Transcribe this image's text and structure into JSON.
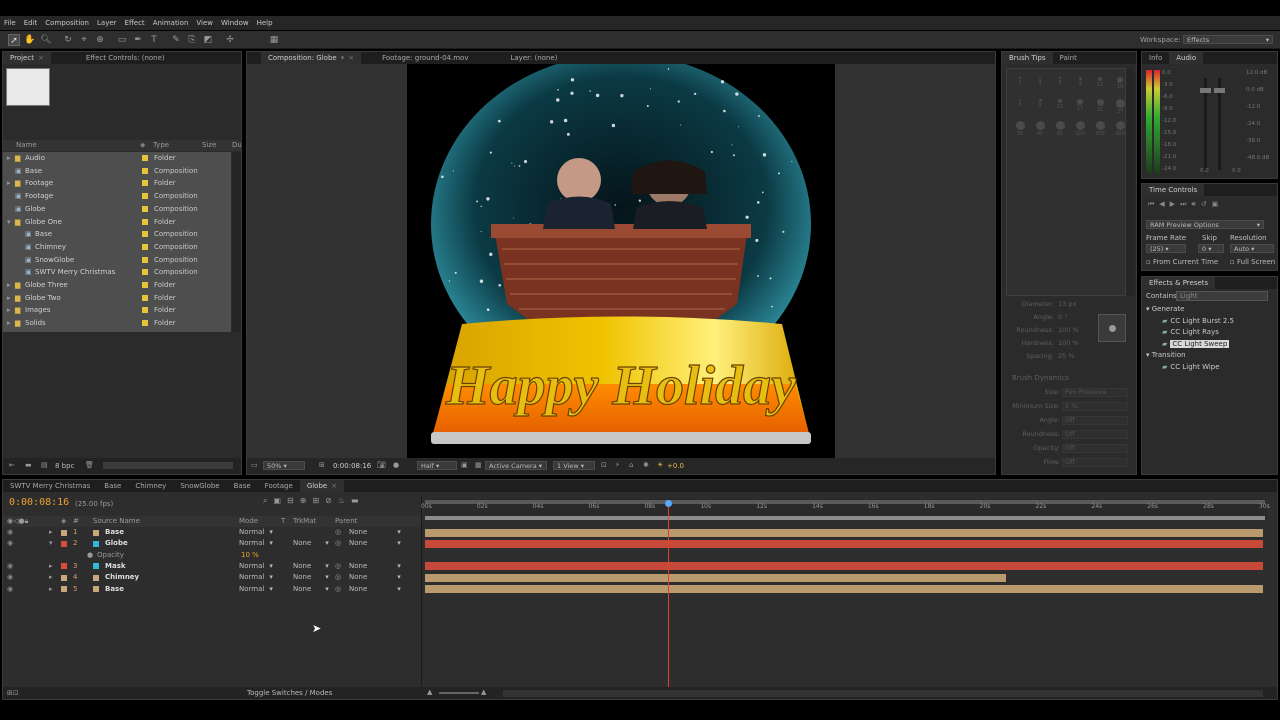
{
  "menu": [
    "File",
    "Edit",
    "Composition",
    "Layer",
    "Effect",
    "Animation",
    "View",
    "Window",
    "Help"
  ],
  "workspace": {
    "label": "Workspace:",
    "value": "Effects"
  },
  "project": {
    "tabs": [
      "Project",
      "Effect Controls: (none)"
    ],
    "columns": [
      "Name",
      "Type",
      "Size",
      "Du"
    ],
    "items": [
      {
        "name": "Audio",
        "type": "Folder",
        "kind": "folder",
        "indent": 0,
        "open": false,
        "color": "#e4c53c"
      },
      {
        "name": "Base",
        "type": "Composition",
        "kind": "comp",
        "indent": 0,
        "open": false,
        "color": "#e4c53c"
      },
      {
        "name": "Footage",
        "type": "Folder",
        "kind": "folder",
        "indent": 0,
        "open": false,
        "color": "#e4c53c"
      },
      {
        "name": "Footage",
        "type": "Composition",
        "kind": "comp",
        "indent": 0,
        "open": false,
        "color": "#e4c53c"
      },
      {
        "name": "Globe",
        "type": "Composition",
        "kind": "comp",
        "indent": 0,
        "open": false,
        "color": "#e4c53c"
      },
      {
        "name": "Globe One",
        "type": "Folder",
        "kind": "folder",
        "indent": 0,
        "open": true,
        "color": "#e4c53c"
      },
      {
        "name": "Base",
        "type": "Composition",
        "kind": "comp",
        "indent": 1,
        "open": false,
        "color": "#e4c53c"
      },
      {
        "name": "Chimney",
        "type": "Composition",
        "kind": "comp",
        "indent": 1,
        "open": false,
        "color": "#e4c53c"
      },
      {
        "name": "SnowGlobe",
        "type": "Composition",
        "kind": "comp",
        "indent": 1,
        "open": false,
        "color": "#e4c53c"
      },
      {
        "name": "SWTV Merry Christmas",
        "type": "Composition",
        "kind": "comp",
        "indent": 1,
        "open": false,
        "color": "#e4c53c"
      },
      {
        "name": "Globe Three",
        "type": "Folder",
        "kind": "folder",
        "indent": 0,
        "open": false,
        "color": "#e4c53c"
      },
      {
        "name": "Globe Two",
        "type": "Folder",
        "kind": "folder",
        "indent": 0,
        "open": false,
        "color": "#e4c53c"
      },
      {
        "name": "Images",
        "type": "Folder",
        "kind": "folder",
        "indent": 0,
        "open": false,
        "color": "#e4c53c"
      },
      {
        "name": "Solids",
        "type": "Folder",
        "kind": "folder",
        "indent": 0,
        "open": false,
        "color": "#e4c53c"
      }
    ],
    "bpc": "8 bpc"
  },
  "viewer": {
    "tabs": [
      "Composition: Globe",
      "Footage: ground-04.mov",
      "Layer: (none)"
    ],
    "snow_text": "Happy Holiday",
    "zoom": "50%",
    "timecode": "0:00:08:16",
    "resolution": "Half",
    "camera": "Active Camera",
    "views": "1 View",
    "exposure": "+0.0"
  },
  "brush": {
    "tabs": [
      "Brush Tips",
      "Paint"
    ],
    "sizes": [
      "1",
      "3",
      "5",
      "9",
      "13",
      "19",
      "5",
      "9",
      "13",
      "17",
      "21",
      "27",
      "35",
      "45",
      "65",
      "100",
      "200",
      "300"
    ],
    "props": [
      {
        "label": "Diameter:",
        "value": "13 px"
      },
      {
        "label": "Angle:",
        "value": "0 °"
      },
      {
        "label": "Roundness:",
        "value": "100 %"
      },
      {
        "label": "Hardness:",
        "value": "100 %"
      },
      {
        "label": "Spacing:",
        "value": "25 %"
      }
    ],
    "dynamics_title": "Brush Dynamics",
    "dynamics": [
      {
        "label": "Size:",
        "value": "Pen Pressure"
      },
      {
        "label": "Minimum Size:",
        "value": "1 %"
      },
      {
        "label": "Angle:",
        "value": "Off"
      },
      {
        "label": "Roundness:",
        "value": "Off"
      },
      {
        "label": "Opacity:",
        "value": "Off"
      },
      {
        "label": "Flow:",
        "value": "Off"
      }
    ]
  },
  "info": {
    "tabs": [
      "Info",
      "Audio"
    ],
    "left": [
      "0.0",
      "-3.0",
      "-6.0",
      "-9.0",
      "-12.0",
      "-15.0",
      "-18.0",
      "-21.0",
      "-24.0"
    ],
    "right": [
      "12.0 dB",
      "0.0 dB",
      "-12.0",
      "-24.0",
      "-36.0",
      "-48.0 dB"
    ],
    "l0": "0.0",
    "l1": "0.0"
  },
  "time_controls": {
    "title": "Time Controls",
    "ram": "RAM Preview Options",
    "labels": [
      "Frame Rate",
      "Skip",
      "Resolution"
    ],
    "values": [
      "(25)",
      "0",
      "Auto"
    ],
    "from_current": "From Current Time",
    "full_screen": "Full Screen"
  },
  "effects": {
    "title": "Effects & Presets",
    "contains_label": "Contains:",
    "contains_value": "Light",
    "groups": [
      {
        "name": "Generate",
        "items": [
          "CC Light Burst 2.5",
          "CC Light Rays",
          "CC Light Sweep"
        ]
      },
      {
        "name": "Transition",
        "items": [
          "CC Light Wipe"
        ]
      }
    ],
    "selected": "CC Light Sweep"
  },
  "timeline": {
    "tabs": [
      "SWTV Merry Christmas",
      "Base",
      "Chimney",
      "SnowGlobe",
      "Base",
      "Footage",
      "Globe"
    ],
    "timecode": "0:00:08:16",
    "fps": "(25.00 fps)",
    "columns": [
      "#",
      "Source Name",
      "Mode",
      "T",
      "TrkMat",
      "Parent"
    ],
    "layers": [
      {
        "num": "1",
        "name": "Base",
        "mode": "Normal",
        "trk": "",
        "parent": "None",
        "label": "#c8a87b",
        "icon": "#c8a87b",
        "bar": "#b89a6e",
        "start": 0,
        "end": 30
      },
      {
        "num": "2",
        "name": "Globe",
        "mode": "Normal",
        "trk": "None",
        "parent": "None",
        "label": "#d84c3c",
        "icon": "#35b7d9",
        "bar": "#c7493a",
        "start": 0,
        "end": 30
      },
      {
        "num": "3",
        "name": "Mask",
        "mode": "Normal",
        "trk": "None",
        "parent": "None",
        "label": "#d84c3c",
        "icon": "#35b7d9",
        "bar": "#c7493a",
        "start": 0,
        "end": 30
      },
      {
        "num": "4",
        "name": "Chimney",
        "mode": "Normal",
        "trk": "None",
        "parent": "None",
        "label": "#c8a87b",
        "icon": "#c8a87b",
        "bar": "#b89a6e",
        "start": 0,
        "end": 20.8
      },
      {
        "num": "5",
        "name": "Base",
        "mode": "Normal",
        "trk": "None",
        "parent": "None",
        "label": "#c8a87b",
        "icon": "#c8a87b",
        "bar": "#b89a6e",
        "start": 0,
        "end": 30
      }
    ],
    "opacity_label": "Opacity",
    "opacity_value": "10 %",
    "ruler": [
      "00s",
      "02s",
      "04s",
      "06s",
      "08s",
      "10s",
      "12s",
      "14s",
      "16s",
      "18s",
      "20s",
      "22s",
      "24s",
      "26s",
      "28s",
      "30s"
    ],
    "current_time": 8.64,
    "duration": 30,
    "toggle": "Toggle Switches / Modes"
  }
}
